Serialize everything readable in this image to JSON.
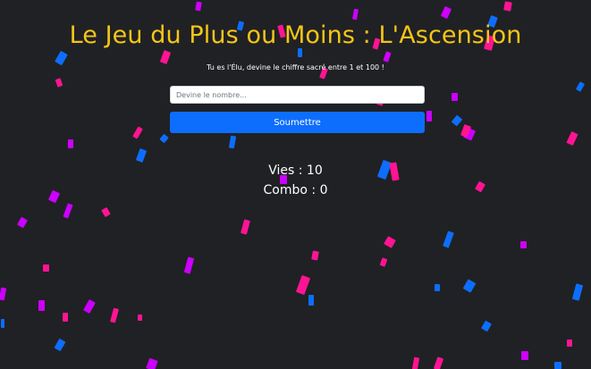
{
  "game": {
    "title": "Le Jeu du Plus ou Moins : L'Ascension",
    "subtitle": "Tu es l'Élu, devine le chiffre sacré entre 1 et 100 !",
    "input_placeholder": "Devine le nombre...",
    "input_value": "",
    "submit_label": "Soumettre",
    "lives_text": "Vies : 10",
    "combo_text": "Combo : 0"
  },
  "colors": {
    "background": "#202124",
    "title": "#f5c518",
    "button": "#0d6efd",
    "confetti": [
      "#0d6efd",
      "#ff1493",
      "#cc00ff"
    ]
  }
}
